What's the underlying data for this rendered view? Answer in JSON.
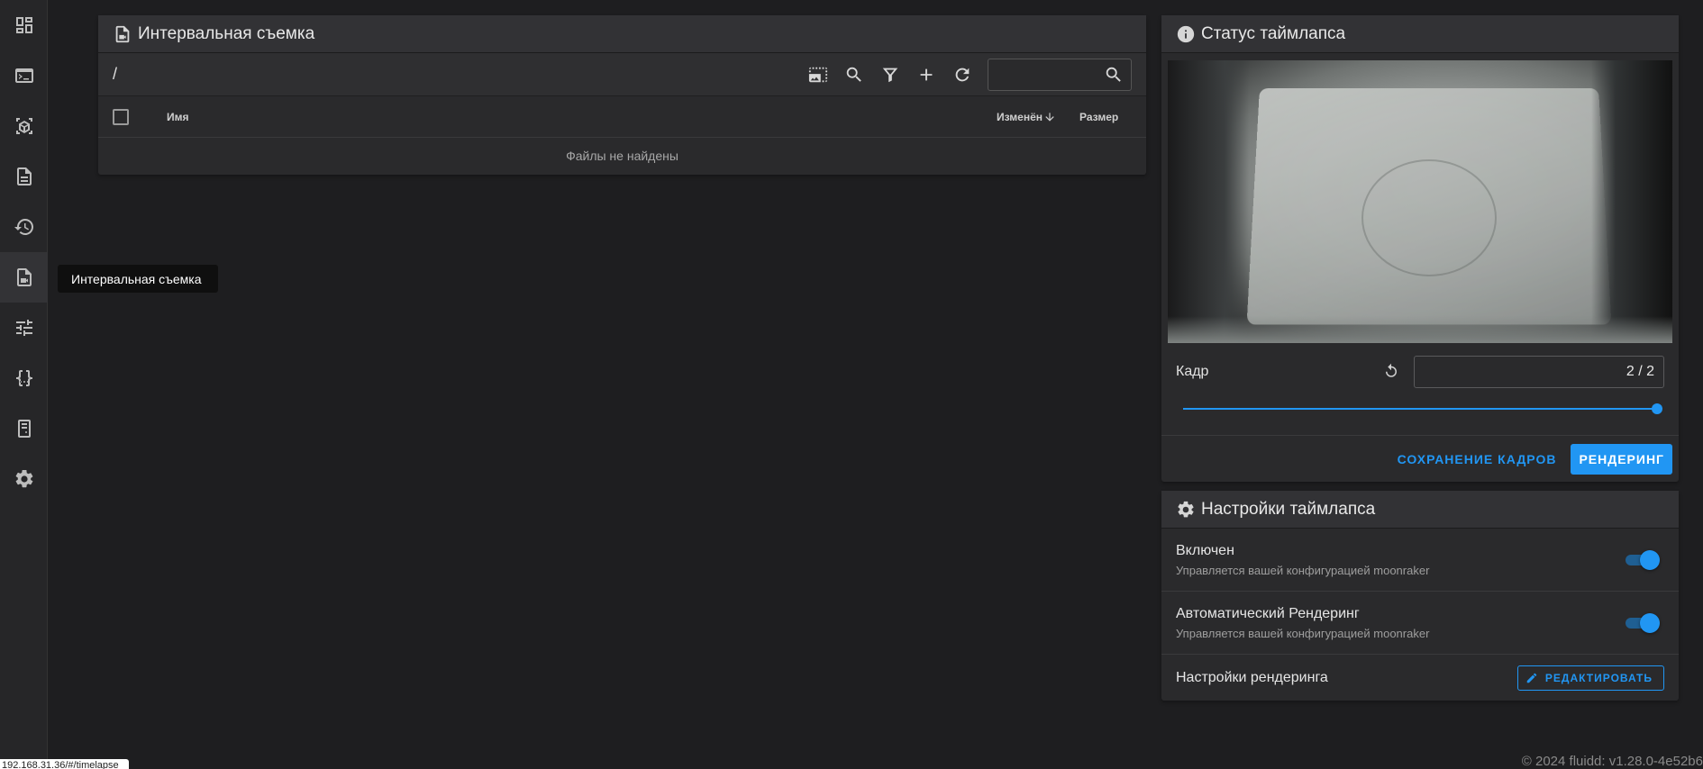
{
  "tooltip": "Интервальная съемка",
  "files": {
    "title": "Интервальная съемка",
    "path": "/",
    "search_placeholder": "",
    "columns": {
      "name": "Имя",
      "modified": "Изменён",
      "size": "Размер"
    },
    "empty_text": "Файлы не найдены"
  },
  "status": {
    "title": "Статус таймлапса",
    "frame_label": "Кадр",
    "frame_value": "2 / 2",
    "frame_current": 2,
    "frame_total": 2,
    "save_frames_label": "СОХРАНЕНИЕ КАДРОВ",
    "render_label": "РЕНДЕРИНГ"
  },
  "settings": {
    "title": "Настройки таймлапса",
    "enabled": {
      "title": "Включен",
      "subtitle": "Управляется вашей конфигурацией moonraker",
      "value": true
    },
    "autorender": {
      "title": "Автоматический Рендеринг",
      "subtitle": "Управляется вашей конфигурацией moonraker",
      "value": true
    },
    "render_settings": {
      "title": "Настройки рендеринга",
      "edit_label": "РЕДАКТИРОВАТЬ"
    }
  },
  "status_url": "192.168.31.36/#/timelapse",
  "footer": "© 2024 fluidd: v1.28.0-4e52b6",
  "colors": {
    "accent": "#2196f3",
    "background": "#1e1e20",
    "card": "#2a2a2c"
  }
}
